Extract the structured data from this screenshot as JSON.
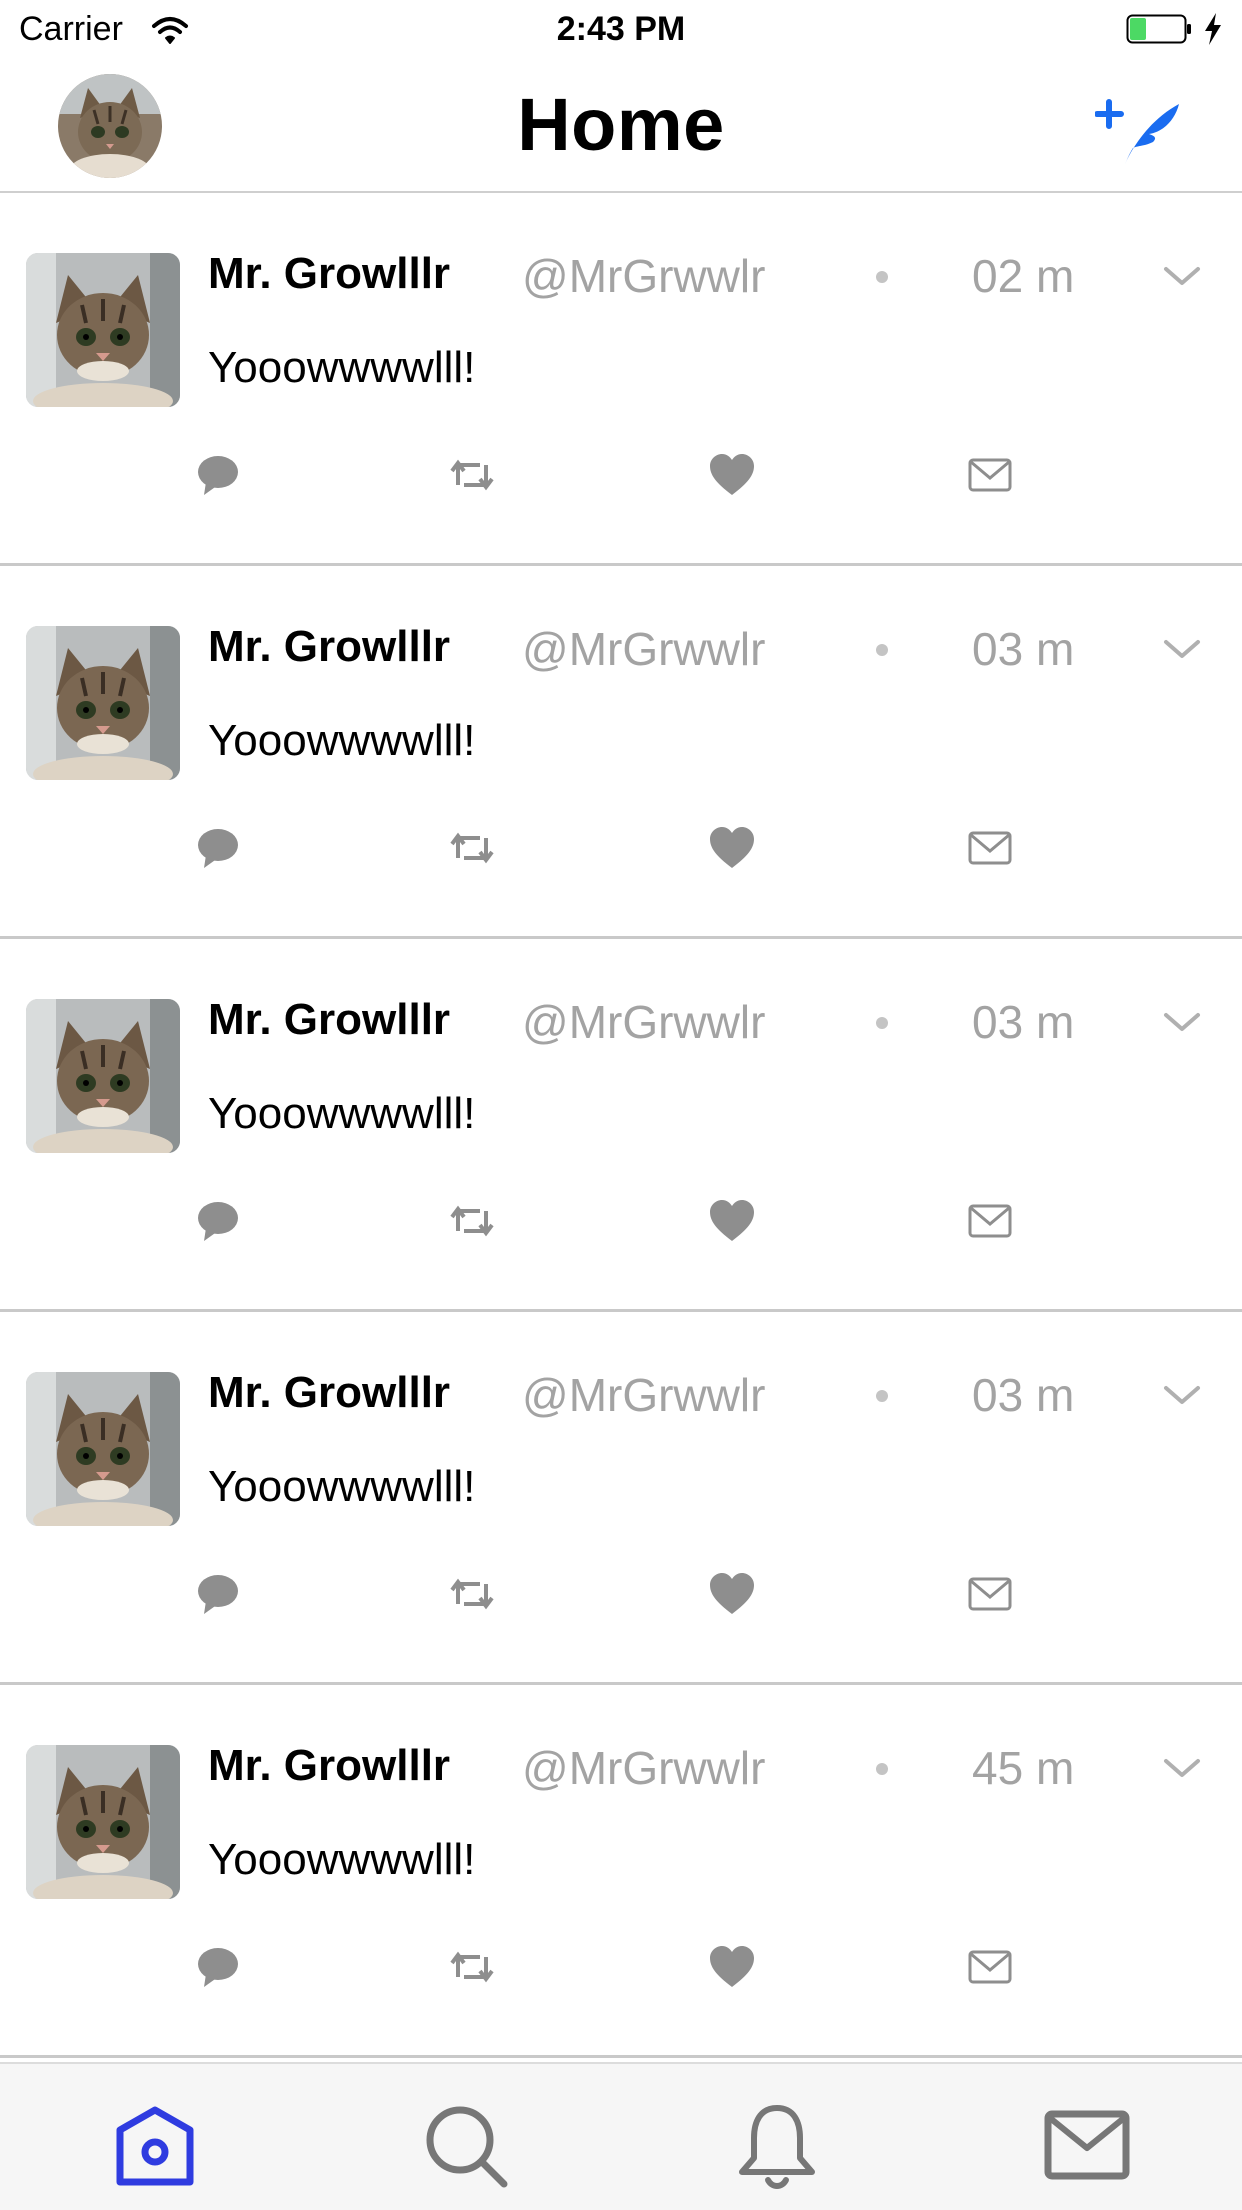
{
  "status_bar": {
    "carrier": "Carrier",
    "time": "2:43 PM",
    "battery_color": "#4cd964"
  },
  "nav": {
    "title": "Home",
    "accent_color": "#1a6cf0",
    "avatar_icon": "cat-avatar",
    "compose_icon": "compose-feather-icon"
  },
  "tweets": [
    {
      "name": "Mr. Growlllr",
      "handle": "@MrGrwwlr",
      "time": "02 m",
      "text": "Yooowwwwlll!"
    },
    {
      "name": "Mr. Growlllr",
      "handle": "@MrGrwwlr",
      "time": "03 m",
      "text": "Yooowwwwlll!"
    },
    {
      "name": "Mr. Growlllr",
      "handle": "@MrGrwwlr",
      "time": "03 m",
      "text": "Yooowwwwlll!"
    },
    {
      "name": "Mr. Growlllr",
      "handle": "@MrGrwwlr",
      "time": "03 m",
      "text": "Yooowwwwlll!"
    },
    {
      "name": "Mr. Growlllr",
      "handle": "@MrGrwwlr",
      "time": "45 m",
      "text": "Yooowwwwlll!"
    }
  ],
  "action_icons": [
    "reply-icon",
    "retweet-icon",
    "like-icon",
    "message-icon"
  ],
  "tab_bar": {
    "tabs": [
      "home-icon",
      "search-icon",
      "notifications-bell-icon",
      "messages-mail-icon"
    ],
    "active_color": "#2f3ce0",
    "inactive_color": "#777777"
  }
}
